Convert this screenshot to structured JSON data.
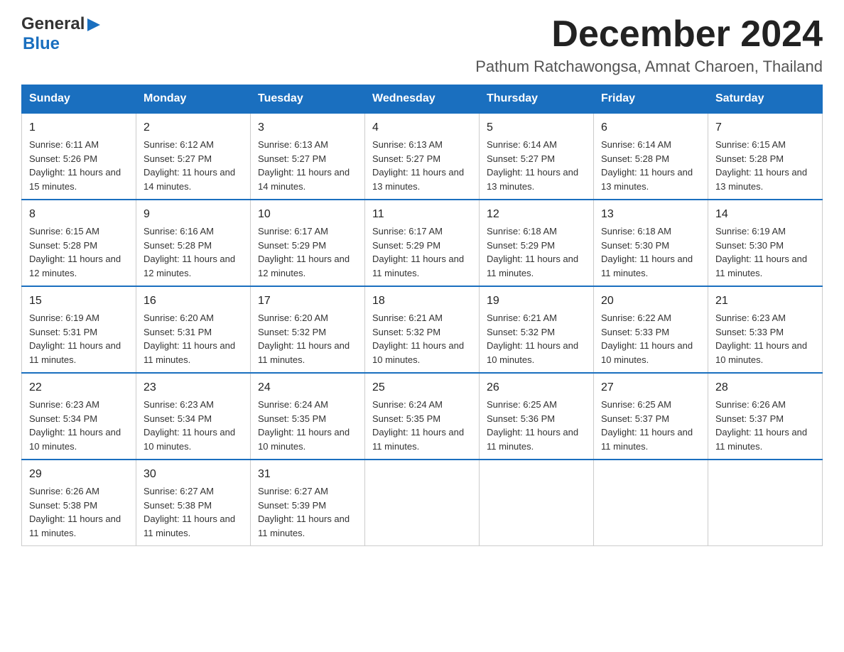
{
  "header": {
    "month_title": "December 2024",
    "subtitle": "Pathum Ratchawongsa, Amnat Charoen, Thailand",
    "logo_general": "General",
    "logo_blue": "Blue"
  },
  "days_of_week": [
    "Sunday",
    "Monday",
    "Tuesday",
    "Wednesday",
    "Thursday",
    "Friday",
    "Saturday"
  ],
  "weeks": [
    [
      {
        "day": "1",
        "sunrise": "Sunrise: 6:11 AM",
        "sunset": "Sunset: 5:26 PM",
        "daylight": "Daylight: 11 hours and 15 minutes."
      },
      {
        "day": "2",
        "sunrise": "Sunrise: 6:12 AM",
        "sunset": "Sunset: 5:27 PM",
        "daylight": "Daylight: 11 hours and 14 minutes."
      },
      {
        "day": "3",
        "sunrise": "Sunrise: 6:13 AM",
        "sunset": "Sunset: 5:27 PM",
        "daylight": "Daylight: 11 hours and 14 minutes."
      },
      {
        "day": "4",
        "sunrise": "Sunrise: 6:13 AM",
        "sunset": "Sunset: 5:27 PM",
        "daylight": "Daylight: 11 hours and 13 minutes."
      },
      {
        "day": "5",
        "sunrise": "Sunrise: 6:14 AM",
        "sunset": "Sunset: 5:27 PM",
        "daylight": "Daylight: 11 hours and 13 minutes."
      },
      {
        "day": "6",
        "sunrise": "Sunrise: 6:14 AM",
        "sunset": "Sunset: 5:28 PM",
        "daylight": "Daylight: 11 hours and 13 minutes."
      },
      {
        "day": "7",
        "sunrise": "Sunrise: 6:15 AM",
        "sunset": "Sunset: 5:28 PM",
        "daylight": "Daylight: 11 hours and 13 minutes."
      }
    ],
    [
      {
        "day": "8",
        "sunrise": "Sunrise: 6:15 AM",
        "sunset": "Sunset: 5:28 PM",
        "daylight": "Daylight: 11 hours and 12 minutes."
      },
      {
        "day": "9",
        "sunrise": "Sunrise: 6:16 AM",
        "sunset": "Sunset: 5:28 PM",
        "daylight": "Daylight: 11 hours and 12 minutes."
      },
      {
        "day": "10",
        "sunrise": "Sunrise: 6:17 AM",
        "sunset": "Sunset: 5:29 PM",
        "daylight": "Daylight: 11 hours and 12 minutes."
      },
      {
        "day": "11",
        "sunrise": "Sunrise: 6:17 AM",
        "sunset": "Sunset: 5:29 PM",
        "daylight": "Daylight: 11 hours and 11 minutes."
      },
      {
        "day": "12",
        "sunrise": "Sunrise: 6:18 AM",
        "sunset": "Sunset: 5:29 PM",
        "daylight": "Daylight: 11 hours and 11 minutes."
      },
      {
        "day": "13",
        "sunrise": "Sunrise: 6:18 AM",
        "sunset": "Sunset: 5:30 PM",
        "daylight": "Daylight: 11 hours and 11 minutes."
      },
      {
        "day": "14",
        "sunrise": "Sunrise: 6:19 AM",
        "sunset": "Sunset: 5:30 PM",
        "daylight": "Daylight: 11 hours and 11 minutes."
      }
    ],
    [
      {
        "day": "15",
        "sunrise": "Sunrise: 6:19 AM",
        "sunset": "Sunset: 5:31 PM",
        "daylight": "Daylight: 11 hours and 11 minutes."
      },
      {
        "day": "16",
        "sunrise": "Sunrise: 6:20 AM",
        "sunset": "Sunset: 5:31 PM",
        "daylight": "Daylight: 11 hours and 11 minutes."
      },
      {
        "day": "17",
        "sunrise": "Sunrise: 6:20 AM",
        "sunset": "Sunset: 5:32 PM",
        "daylight": "Daylight: 11 hours and 11 minutes."
      },
      {
        "day": "18",
        "sunrise": "Sunrise: 6:21 AM",
        "sunset": "Sunset: 5:32 PM",
        "daylight": "Daylight: 11 hours and 10 minutes."
      },
      {
        "day": "19",
        "sunrise": "Sunrise: 6:21 AM",
        "sunset": "Sunset: 5:32 PM",
        "daylight": "Daylight: 11 hours and 10 minutes."
      },
      {
        "day": "20",
        "sunrise": "Sunrise: 6:22 AM",
        "sunset": "Sunset: 5:33 PM",
        "daylight": "Daylight: 11 hours and 10 minutes."
      },
      {
        "day": "21",
        "sunrise": "Sunrise: 6:23 AM",
        "sunset": "Sunset: 5:33 PM",
        "daylight": "Daylight: 11 hours and 10 minutes."
      }
    ],
    [
      {
        "day": "22",
        "sunrise": "Sunrise: 6:23 AM",
        "sunset": "Sunset: 5:34 PM",
        "daylight": "Daylight: 11 hours and 10 minutes."
      },
      {
        "day": "23",
        "sunrise": "Sunrise: 6:23 AM",
        "sunset": "Sunset: 5:34 PM",
        "daylight": "Daylight: 11 hours and 10 minutes."
      },
      {
        "day": "24",
        "sunrise": "Sunrise: 6:24 AM",
        "sunset": "Sunset: 5:35 PM",
        "daylight": "Daylight: 11 hours and 10 minutes."
      },
      {
        "day": "25",
        "sunrise": "Sunrise: 6:24 AM",
        "sunset": "Sunset: 5:35 PM",
        "daylight": "Daylight: 11 hours and 11 minutes."
      },
      {
        "day": "26",
        "sunrise": "Sunrise: 6:25 AM",
        "sunset": "Sunset: 5:36 PM",
        "daylight": "Daylight: 11 hours and 11 minutes."
      },
      {
        "day": "27",
        "sunrise": "Sunrise: 6:25 AM",
        "sunset": "Sunset: 5:37 PM",
        "daylight": "Daylight: 11 hours and 11 minutes."
      },
      {
        "day": "28",
        "sunrise": "Sunrise: 6:26 AM",
        "sunset": "Sunset: 5:37 PM",
        "daylight": "Daylight: 11 hours and 11 minutes."
      }
    ],
    [
      {
        "day": "29",
        "sunrise": "Sunrise: 6:26 AM",
        "sunset": "Sunset: 5:38 PM",
        "daylight": "Daylight: 11 hours and 11 minutes."
      },
      {
        "day": "30",
        "sunrise": "Sunrise: 6:27 AM",
        "sunset": "Sunset: 5:38 PM",
        "daylight": "Daylight: 11 hours and 11 minutes."
      },
      {
        "day": "31",
        "sunrise": "Sunrise: 6:27 AM",
        "sunset": "Sunset: 5:39 PM",
        "daylight": "Daylight: 11 hours and 11 minutes."
      },
      null,
      null,
      null,
      null
    ]
  ]
}
